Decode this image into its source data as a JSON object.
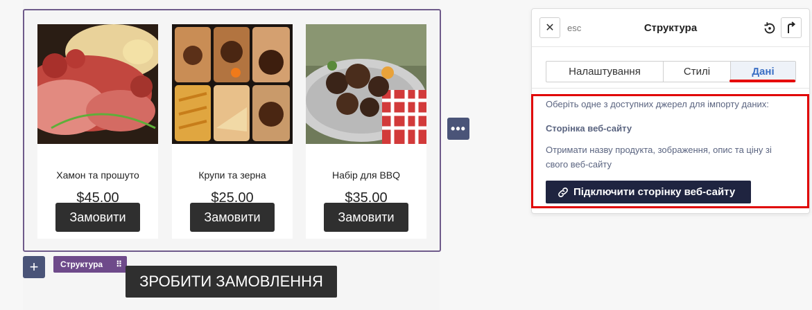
{
  "products": [
    {
      "title": "Хамон та прошуто",
      "price": "$45.00",
      "button": "Замовити"
    },
    {
      "title": "Крупи та зерна",
      "price": "$25.00",
      "button": "Замовити"
    },
    {
      "title": "Набір для BBQ",
      "price": "$35.00",
      "button": "Замовити"
    }
  ],
  "toolbar": {
    "structure_tag": "Структура",
    "order_button": "ЗРОБИТИ ЗАМОВЛЕННЯ",
    "plus": "+",
    "more": "•••"
  },
  "panel": {
    "esc_label": "esc",
    "title": "Структура",
    "tabs": [
      "Налаштування",
      "Стилі",
      "Дані"
    ],
    "active_tab": "Дані",
    "intro": "Оберіть одне з доступних джерел для імпорту даних:",
    "source_title": "Сторінка веб-сайту",
    "source_desc": "Отримати назву продукта, зображення, опис та ціну зі свого веб-сайту",
    "connect_button": "Підключити сторінку веб-сайту"
  },
  "colors": {
    "accent": "#3a6fc4",
    "highlight": "#e00000",
    "structure_border": "#6e5a8a",
    "dark_button": "#2f2f2f",
    "navy_button": "#1f2440"
  }
}
